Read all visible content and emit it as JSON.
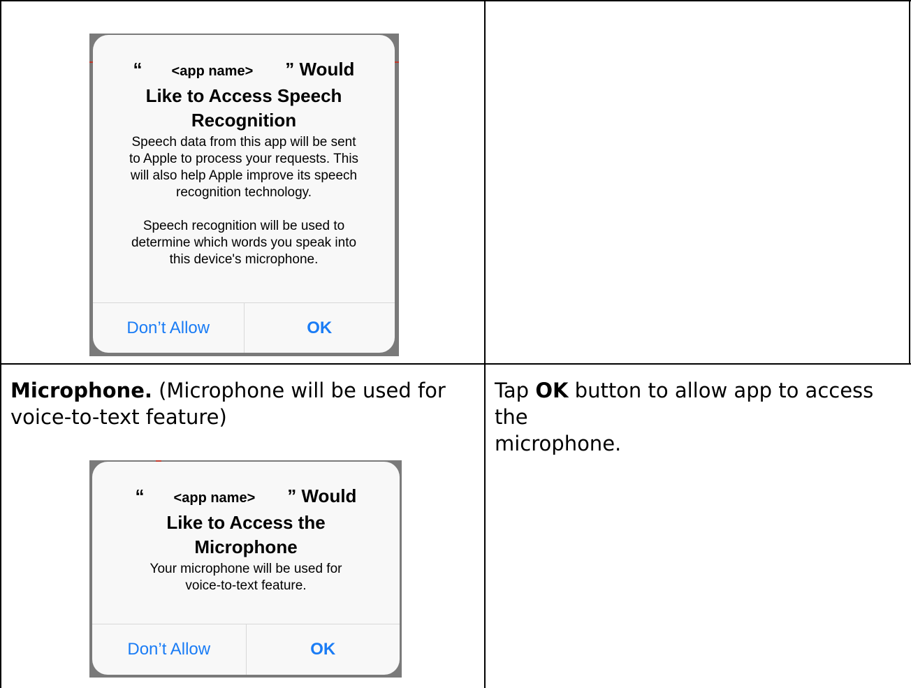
{
  "dialog_speech": {
    "title_open_quote": "“",
    "title_app_name": "<app name>",
    "title_close_quote_would": "” Would",
    "title_line2": "Like to Access Speech",
    "title_line3": "Recognition",
    "msg_p1_l1": "Speech data from this app will be sent",
    "msg_p1_l2": "to Apple to process your requests. This",
    "msg_p1_l3": "will also help Apple improve its speech",
    "msg_p1_l4": "recognition technology.",
    "msg_p2_l1": "Speech recognition will be used to",
    "msg_p2_l2": "determine which words you speak into",
    "msg_p2_l3": "this device's microphone.",
    "deny_label": "Don’t Allow",
    "ok_label": "OK"
  },
  "row2_left": {
    "heading": "Microphone.",
    "text_line1": "(Microphone will be used for",
    "text_line2": "voice-to-text feature)"
  },
  "row2_right": {
    "text_pre": "Tap ",
    "text_bold": "OK",
    "text_line1_post": " button to allow app to access the",
    "text_line2": "microphone."
  },
  "dialog_mic": {
    "title_open_quote": "“",
    "title_app_name": "<app name>",
    "title_close_quote_would": "” Would",
    "title_line2": "Like to Access the",
    "title_line3": "Microphone",
    "msg_l1": "Your microphone will be used for",
    "msg_l2": "voice-to-text feature.",
    "deny_label": "Don’t Allow",
    "ok_label": "OK"
  },
  "colors": {
    "ios_blue": "#1a7cf5",
    "dialog_bg": "#f8f8f8",
    "border": "#000000"
  }
}
